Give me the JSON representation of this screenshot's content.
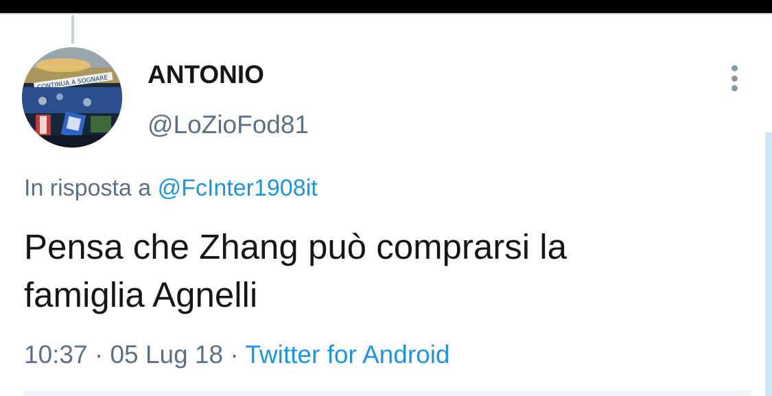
{
  "tweet": {
    "display_name": "ANTONIO",
    "handle": "@LoZioFod81",
    "reply_prefix": "In risposta a",
    "reply_mention": "@FcInter1908it",
    "text_line1": "Pensa che Zhang può comprarsi la",
    "text_line2": "famiglia Agnelli",
    "time": "10:37",
    "separator": "·",
    "date": "05 Lug 18",
    "source": "Twitter for Android",
    "avatar_banner_text": "CONTINUA A SOGNARE"
  },
  "icons": {
    "more": "more-vertical-icon"
  },
  "colors": {
    "link": "#1b95e0",
    "secondary_text": "#5b7083",
    "primary_text": "#14171a"
  }
}
